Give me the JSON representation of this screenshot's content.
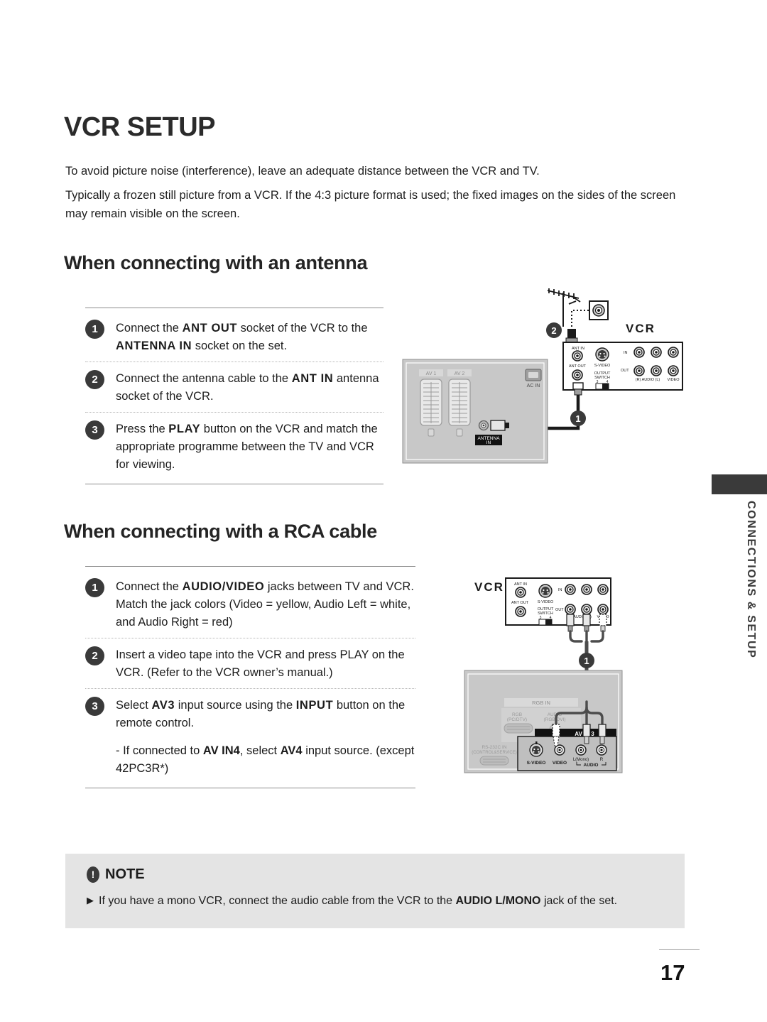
{
  "page": {
    "title": "VCR SETUP",
    "number": "17",
    "side_tab_label": "CONNECTIONS & SETUP"
  },
  "intro": {
    "line1": "To avoid picture noise (interference), leave an adequate distance between the VCR and TV.",
    "line2": "Typically a frozen still picture from a VCR. If the 4:3 picture format is used; the fixed images on the sides of the screen may remain visible on the screen."
  },
  "sections": {
    "antenna": {
      "heading": "When connecting with an antenna",
      "steps": [
        {
          "n": "1",
          "pre": "Connect the ",
          "b1": "ANT OUT",
          "mid": " socket of the VCR to the ",
          "b2": "ANTENNA IN",
          "post": " socket on the set."
        },
        {
          "n": "2",
          "pre": "Connect the antenna cable to the ",
          "b1": "ANT IN",
          "mid": " antenna socket of the VCR.",
          "b2": "",
          "post": ""
        },
        {
          "n": "3",
          "pre": "Press the ",
          "b1": "PLAY",
          "mid": " button on the VCR and match the appropriate programme between the TV and VCR for  viewing.",
          "b2": "",
          "post": ""
        }
      ]
    },
    "rca": {
      "heading": "When connecting with a RCA cable",
      "steps": [
        {
          "n": "1",
          "pre": "Connect the ",
          "b1": "AUDIO/VIDEO",
          "mid": " jacks  between TV and VCR. Match the jack colors (Video = yellow, Audio Left = white, and Audio Right = red)",
          "b2": "",
          "post": ""
        },
        {
          "n": "2",
          "pre": "Insert a video tape into the VCR and press PLAY on the VCR. (Refer to the VCR owner’s manual.)",
          "b1": "",
          "mid": "",
          "b2": "",
          "post": ""
        },
        {
          "n": "3",
          "pre": "Select ",
          "b1": "AV3",
          "mid": " input source using the ",
          "b2": "INPUT",
          "post": " button on the remote control."
        }
      ],
      "subnote": {
        "pre": "- If connected to ",
        "b1": "AV IN4",
        "mid": ", select ",
        "b2": "AV4",
        "post": " input source. (except 42PC3R*)"
      }
    }
  },
  "note": {
    "title": "NOTE",
    "bullet": "If you have a mono VCR, connect the audio cable from the VCR to the ",
    "bold": "AUDIO L/MONO",
    "tail": " jack of the set."
  },
  "diagram_antenna": {
    "vcr_label": "VCR",
    "callout_1": "1",
    "callout_2": "2",
    "tv_ports": {
      "av1": "AV 1",
      "av2": "AV 2",
      "ac_in": "AC IN",
      "antenna_in": "ANTENNA",
      "antenna_in2": "IN"
    },
    "vcr_ports": {
      "ant_in": "ANT IN",
      "ant_out": "ANT OUT",
      "s_video": "S-VIDEO",
      "output": "OUTPUT",
      "switch": "SWITCH",
      "sw3": "3",
      "sw4": "4",
      "in": "IN",
      "out": "OUT",
      "audio": "(R) AUDIO (L)",
      "video": "VIDEO"
    }
  },
  "diagram_rca": {
    "vcr_label": "VCR",
    "callout_1": "1",
    "vcr_ports": {
      "ant_in": "ANT IN",
      "ant_out": "ANT OUT",
      "s_video": "S-VIDEO",
      "output": "OUTPUT",
      "switch": "SWITCH",
      "sw3": "3",
      "sw4": "4",
      "in": "IN",
      "out": "OUT",
      "audio": "AUDIO (L)",
      "video": "VIDEO"
    },
    "tv_ports": {
      "rgb_in": "RGB IN",
      "rgb": "RGB",
      "pcdtv": "(PC/DTV)",
      "audio": "AUDIO",
      "rgbdvi": "(RGB/DVI)",
      "rs232c": "RS-232C IN",
      "ctrl": "(CONTROL&SERVICE)",
      "av_in3": "AV IN 3",
      "s_video": "S-VIDEO",
      "video": "VIDEO",
      "l_mono": "L(Mono)",
      "r": "R",
      "audio_lbl": "AUDIO"
    }
  }
}
